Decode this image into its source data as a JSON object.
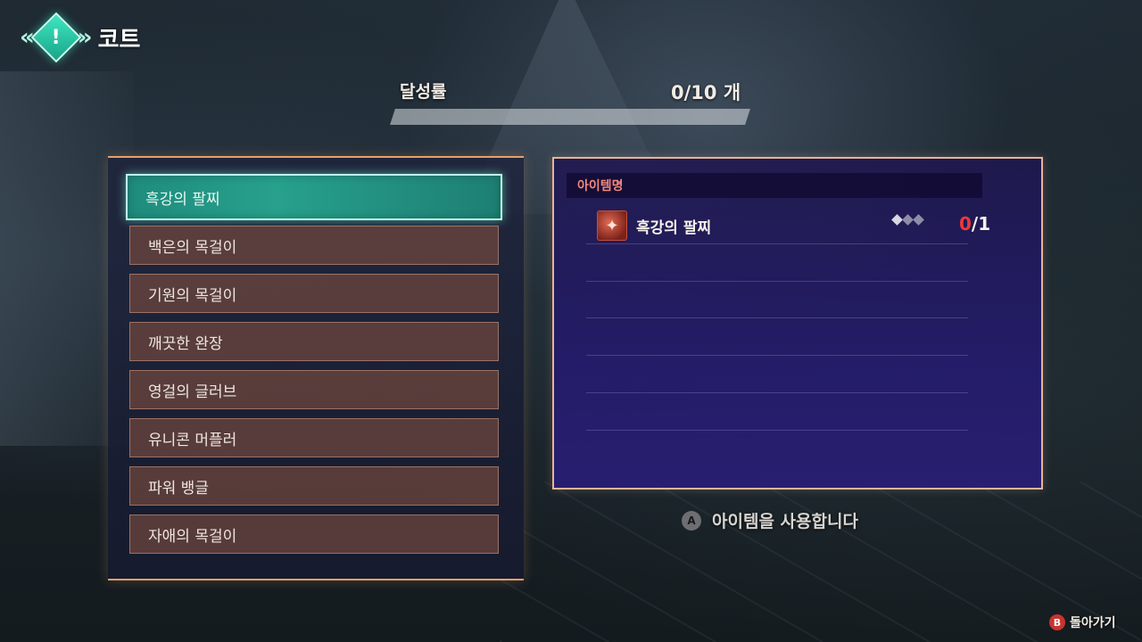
{
  "header": {
    "left_chevron": "«",
    "badge_glyph": "!",
    "right_chevron": "»",
    "title": "코트"
  },
  "progress": {
    "label": "달성률",
    "count_text": "0/10 개",
    "fraction": 0
  },
  "list": {
    "items": [
      {
        "label": "흑강의 팔찌",
        "selected": true
      },
      {
        "label": "백은의 목걸이",
        "selected": false
      },
      {
        "label": "기원의 목걸이",
        "selected": false
      },
      {
        "label": "깨끗한 완장",
        "selected": false
      },
      {
        "label": "영걸의 글러브",
        "selected": false
      },
      {
        "label": "유니콘 머플러",
        "selected": false
      },
      {
        "label": "파워 뱅글",
        "selected": false
      },
      {
        "label": "자애의 목걸이",
        "selected": false
      }
    ]
  },
  "detail": {
    "header": "아이템명",
    "item": {
      "icon": "bird-emblem-icon",
      "icon_glyph": "✦",
      "name": "흑강의 팔찌",
      "rarity_filled": 1,
      "rarity_total": 3,
      "have": "0",
      "need": "/1"
    }
  },
  "hints": {
    "a_button": "A",
    "a_text": "아이템을 사용합니다",
    "b_button": "B",
    "b_text": "돌아가기"
  },
  "colors": {
    "accent_teal": "#27a08c",
    "panel_border": "#e8a06a",
    "count_red": "#e83a3a",
    "detail_header": "#f2877a"
  }
}
